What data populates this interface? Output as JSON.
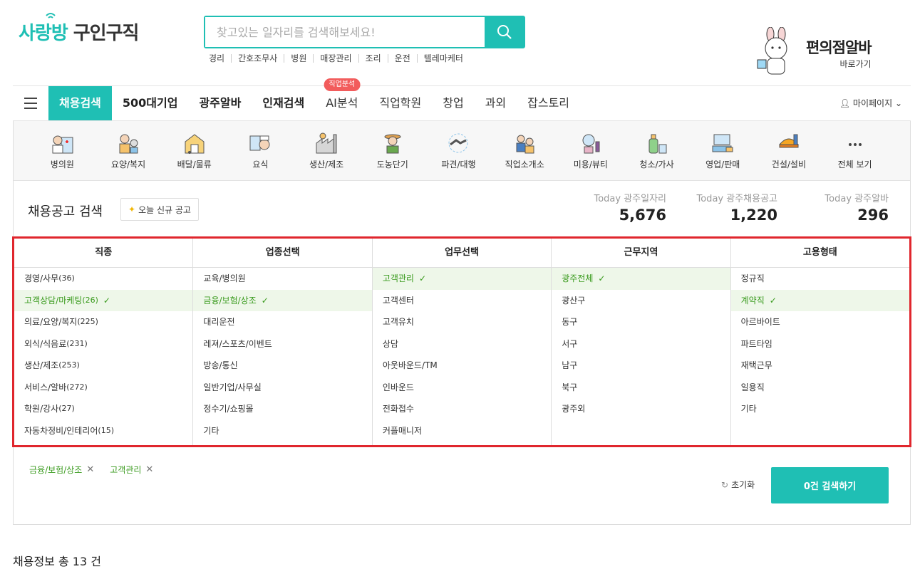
{
  "header": {
    "logo_part1": "사랑방",
    "logo_part2": "구인구직",
    "search_placeholder": "찾고있는 일자리를 검색해보세요!",
    "search_button_icon": "search-icon",
    "keywords": [
      "경리",
      "간호조무사",
      "병원",
      "매장관리",
      "조리",
      "운전",
      "텔레마케터"
    ],
    "promo_title": "편의점알바",
    "promo_sub": "바로가기"
  },
  "nav": {
    "items": [
      {
        "label": "채용검색",
        "active": true
      },
      {
        "label": "500대기업"
      },
      {
        "label": "광주알바"
      },
      {
        "label": "인재검색"
      },
      {
        "label": "AI분석",
        "badge": "직업분석"
      },
      {
        "label": "직업학원"
      },
      {
        "label": "창업"
      },
      {
        "label": "과외"
      },
      {
        "label": "잡스토리"
      }
    ],
    "mypage": "마이페이지"
  },
  "categories": [
    {
      "label": "병의원",
      "icon": "doctor-icon"
    },
    {
      "label": "요양/복지",
      "icon": "caregiver-icon"
    },
    {
      "label": "배달/물류",
      "icon": "delivery-icon"
    },
    {
      "label": "요식",
      "icon": "cook-icon"
    },
    {
      "label": "생산/제조",
      "icon": "factory-icon"
    },
    {
      "label": "도농단기",
      "icon": "farmer-icon"
    },
    {
      "label": "파견/대행",
      "icon": "handshake-icon"
    },
    {
      "label": "직업소개소",
      "icon": "agent-icon"
    },
    {
      "label": "미용/뷰티",
      "icon": "beauty-icon"
    },
    {
      "label": "청소/가사",
      "icon": "cleaning-icon"
    },
    {
      "label": "영업/판매",
      "icon": "sales-icon"
    },
    {
      "label": "건설/설비",
      "icon": "construction-icon"
    },
    {
      "label": "전체 보기",
      "icon": "more-icon"
    }
  ],
  "search_section": {
    "title": "채용공고 검색",
    "today_button": "오늘 신규 공고",
    "stats": [
      {
        "label": "Today 광주일자리",
        "value": "5,676"
      },
      {
        "label": "Today 광주채용공고",
        "value": "1,220"
      },
      {
        "label": "Today 광주알바",
        "value": "296"
      }
    ]
  },
  "filters": {
    "columns": [
      {
        "header": "직종",
        "options": [
          {
            "label": "경영/사무",
            "count": "(36)"
          },
          {
            "label": "고객상담/마케팅",
            "count": "(26)",
            "selected": true
          },
          {
            "label": "의료/요양/복지",
            "count": "(225)"
          },
          {
            "label": "외식/식음료",
            "count": "(231)"
          },
          {
            "label": "생산/제조",
            "count": "(253)"
          },
          {
            "label": "서비스/알바",
            "count": "(272)"
          },
          {
            "label": "학원/강사",
            "count": "(27)"
          },
          {
            "label": "자동차정비/인테리어",
            "count": "(15)"
          }
        ]
      },
      {
        "header": "업종선택",
        "options": [
          {
            "label": "교육/병의원"
          },
          {
            "label": "금융/보험/상조",
            "selected": true
          },
          {
            "label": "대리운전"
          },
          {
            "label": "레져/스포츠/이벤트"
          },
          {
            "label": "방송/통신"
          },
          {
            "label": "일반기업/사무실"
          },
          {
            "label": "정수기/쇼핑몰"
          },
          {
            "label": "기타"
          }
        ]
      },
      {
        "header": "업무선택",
        "options": [
          {
            "label": "고객관리",
            "selected": true
          },
          {
            "label": "고객센터"
          },
          {
            "label": "고객유치"
          },
          {
            "label": "상담"
          },
          {
            "label": "아웃바운드/TM"
          },
          {
            "label": "인바운드"
          },
          {
            "label": "전화접수"
          },
          {
            "label": "커플매니저"
          }
        ]
      },
      {
        "header": "근무지역",
        "options": [
          {
            "label": "광주전체",
            "selected": true
          },
          {
            "label": "광산구"
          },
          {
            "label": "동구"
          },
          {
            "label": "서구"
          },
          {
            "label": "남구"
          },
          {
            "label": "북구"
          },
          {
            "label": "광주외"
          }
        ]
      },
      {
        "header": "고용형태",
        "options": [
          {
            "label": "정규직"
          },
          {
            "label": "계약직",
            "selected": true
          },
          {
            "label": "아르바이트"
          },
          {
            "label": "파트타임"
          },
          {
            "label": "재택근무"
          },
          {
            "label": "일용직"
          },
          {
            "label": "기타"
          }
        ]
      }
    ]
  },
  "selected_tags": [
    "금융/보험/상조",
    "고객관리"
  ],
  "actions": {
    "reset": "초기화",
    "search": "0건 검색하기"
  },
  "total": "채용정보 총 13 건",
  "colors": {
    "accent": "#1fbfb4",
    "selected_text": "#3a9b1e",
    "selected_bg": "#eef7e9",
    "highlight_border": "#e0262d",
    "badge": "#f25c5c"
  }
}
